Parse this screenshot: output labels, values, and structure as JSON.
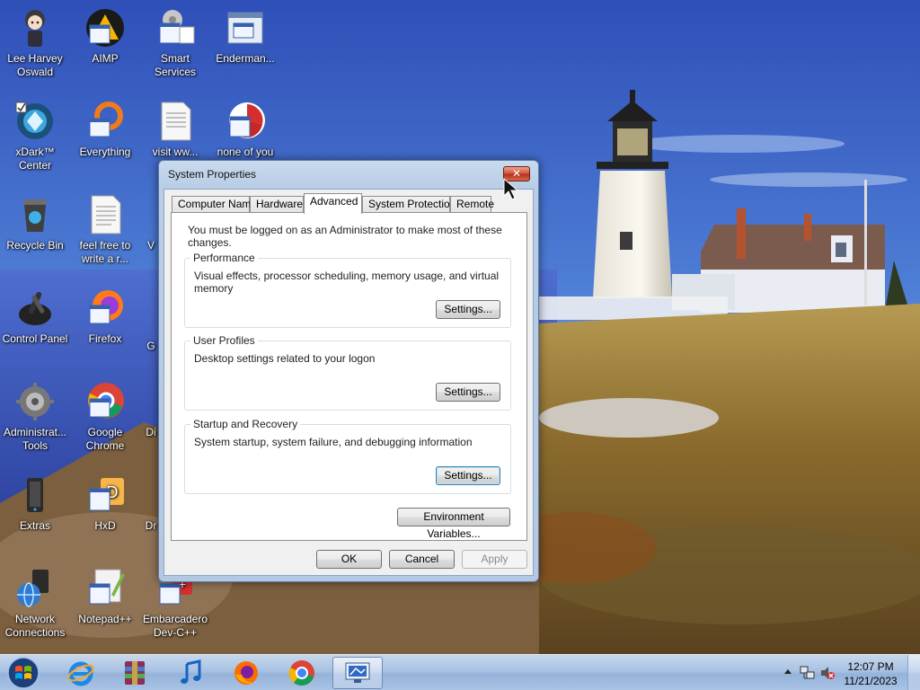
{
  "desktop": {
    "icons": [
      {
        "label": "Lee Harvey Oswald",
        "icon": "anime-character-icon"
      },
      {
        "label": "AIMP",
        "icon": "aimp-icon"
      },
      {
        "label": "Smart Services",
        "icon": "gear-app-icon"
      },
      {
        "label": "Enderman...",
        "icon": "app-window-icon"
      },
      {
        "label": "xDark™ Center",
        "icon": "xdark-icon"
      },
      {
        "label": "Everything",
        "icon": "everything-search-icon"
      },
      {
        "label": "visit ww...",
        "icon": "text-document-icon"
      },
      {
        "label": "none of you",
        "icon": "app-red-icon"
      },
      {
        "label": "Recycle Bin",
        "icon": "recycle-bin-icon"
      },
      {
        "label": "feel free to write a r...",
        "icon": "text-document-icon"
      },
      {
        "label": "V",
        "icon": "partial-icon"
      },
      {
        "label": "Control Panel",
        "icon": "control-panel-icon"
      },
      {
        "label": "Firefox",
        "icon": "firefox-icon"
      },
      {
        "label": "G",
        "icon": "partial-icon"
      },
      {
        "label": "Administrat... Tools",
        "icon": "admin-tools-icon"
      },
      {
        "label": "Google Chrome",
        "icon": "chrome-icon"
      },
      {
        "label": "Di",
        "icon": "partial-icon"
      },
      {
        "label": "Extras",
        "icon": "extras-icon"
      },
      {
        "label": "HxD",
        "icon": "hxd-icon"
      },
      {
        "label": "Dr",
        "icon": "partial-icon"
      },
      {
        "label": "Network Connections",
        "icon": "network-icon"
      },
      {
        "label": "Notepad++",
        "icon": "notepadpp-icon"
      },
      {
        "label": "Embarcadero Dev-C++",
        "icon": "devcpp-icon"
      }
    ]
  },
  "dialog": {
    "title": "System Properties",
    "close_label": "✕",
    "tabs": [
      {
        "label": "Computer Name"
      },
      {
        "label": "Hardware"
      },
      {
        "label": "Advanced"
      },
      {
        "label": "System Protection"
      },
      {
        "label": "Remote"
      }
    ],
    "active_tab": "Advanced",
    "admin_message": "You must be logged on as an Administrator to make most of these changes.",
    "groups": [
      {
        "title": "Performance",
        "description": "Visual effects, processor scheduling, memory usage, and virtual memory",
        "button": "Settings..."
      },
      {
        "title": "User Profiles",
        "description": "Desktop settings related to your logon",
        "button": "Settings..."
      },
      {
        "title": "Startup and Recovery",
        "description": "System startup, system failure, and debugging information",
        "button": "Settings..."
      }
    ],
    "env_button": "Environment Variables...",
    "ok_label": "OK",
    "cancel_label": "Cancel",
    "apply_label": "Apply"
  },
  "taskbar": {
    "pinned": [
      {
        "name": "internet-explorer-icon"
      },
      {
        "name": "winrar-icon"
      },
      {
        "name": "music-note-icon"
      },
      {
        "name": "firefox-icon"
      },
      {
        "name": "chrome-icon"
      },
      {
        "name": "system-properties-icon"
      }
    ],
    "clock_time": "12:07 PM",
    "clock_date": "11/21/2023"
  }
}
